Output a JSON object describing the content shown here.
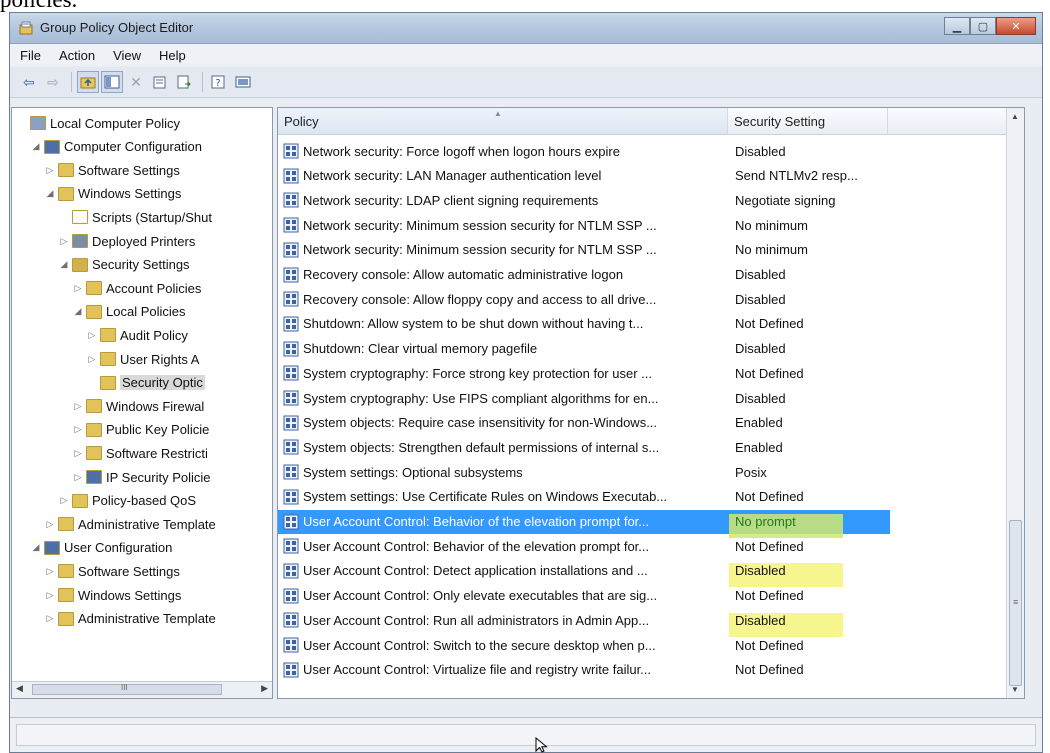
{
  "page_fragment": "policies.",
  "window": {
    "title": "Group Policy Object Editor",
    "buttons": [
      "minimize",
      "maximize",
      "close"
    ]
  },
  "menubar": [
    "File",
    "Action",
    "View",
    "Help"
  ],
  "toolbar": {
    "icons": [
      "back-icon",
      "forward-icon",
      "up-folder-icon",
      "show-hide-tree-icon",
      "delete-icon",
      "properties-icon",
      "export-list-icon",
      "help-icon",
      "console-view-icon"
    ]
  },
  "tree": {
    "nodes": [
      {
        "label": "Local Computer Policy",
        "depth": 0,
        "expander": "",
        "icon": "policy-icon"
      },
      {
        "label": "Computer Configuration",
        "depth": 1,
        "expander": "◢",
        "icon": "computer-icon"
      },
      {
        "label": "Software Settings",
        "depth": 2,
        "expander": "▷",
        "icon": "folder-icon"
      },
      {
        "label": "Windows Settings",
        "depth": 2,
        "expander": "◢",
        "icon": "folder-icon"
      },
      {
        "label": "Scripts (Startup/Shut",
        "depth": 3,
        "expander": "",
        "icon": "script-icon"
      },
      {
        "label": "Deployed Printers",
        "depth": 3,
        "expander": "▷",
        "icon": "printer-icon"
      },
      {
        "label": "Security Settings",
        "depth": 3,
        "expander": "◢",
        "icon": "security-icon"
      },
      {
        "label": "Account Policies",
        "depth": 4,
        "expander": "▷",
        "icon": "policy-folder-icon"
      },
      {
        "label": "Local Policies",
        "depth": 4,
        "expander": "◢",
        "icon": "policy-folder-icon"
      },
      {
        "label": "Audit Policy",
        "depth": 5,
        "expander": "▷",
        "icon": "policy-folder-icon"
      },
      {
        "label": "User Rights A",
        "depth": 5,
        "expander": "▷",
        "icon": "policy-folder-icon"
      },
      {
        "label": "Security Optic",
        "depth": 5,
        "expander": "",
        "icon": "policy-folder-icon",
        "selected": true
      },
      {
        "label": "Windows Firewal",
        "depth": 4,
        "expander": "▷",
        "icon": "folder-icon"
      },
      {
        "label": "Public Key Policie",
        "depth": 4,
        "expander": "▷",
        "icon": "folder-icon"
      },
      {
        "label": "Software Restricti",
        "depth": 4,
        "expander": "▷",
        "icon": "folder-icon"
      },
      {
        "label": "IP Security Policie",
        "depth": 4,
        "expander": "▷",
        "icon": "ipsec-icon"
      },
      {
        "label": "Policy-based QoS",
        "depth": 3,
        "expander": "▷",
        "icon": "qos-icon"
      },
      {
        "label": "Administrative Template",
        "depth": 2,
        "expander": "▷",
        "icon": "folder-icon"
      },
      {
        "label": "User Configuration",
        "depth": 1,
        "expander": "◢",
        "icon": "user-icon"
      },
      {
        "label": "Software Settings",
        "depth": 2,
        "expander": "▷",
        "icon": "folder-icon"
      },
      {
        "label": "Windows Settings",
        "depth": 2,
        "expander": "▷",
        "icon": "folder-icon"
      },
      {
        "label": "Administrative Template",
        "depth": 2,
        "expander": "▷",
        "icon": "folder-icon"
      }
    ],
    "scroll_glyph": "III"
  },
  "list": {
    "columns": {
      "policy": "Policy",
      "setting": "Security Setting",
      "extra": ""
    },
    "rows": [
      {
        "policy": "Network security: Force logoff when logon hours expire",
        "setting": "Disabled"
      },
      {
        "policy": "Network security: LAN Manager authentication level",
        "setting": "Send NTLMv2 resp..."
      },
      {
        "policy": "Network security: LDAP client signing requirements",
        "setting": "Negotiate signing"
      },
      {
        "policy": "Network security: Minimum session security for NTLM SSP ...",
        "setting": "No minimum"
      },
      {
        "policy": "Network security: Minimum session security for NTLM SSP ...",
        "setting": "No minimum"
      },
      {
        "policy": "Recovery console: Allow automatic administrative logon",
        "setting": "Disabled"
      },
      {
        "policy": "Recovery console: Allow floppy copy and access to all drive...",
        "setting": "Disabled"
      },
      {
        "policy": "Shutdown: Allow system to be shut down without having t...",
        "setting": "Not Defined"
      },
      {
        "policy": "Shutdown: Clear virtual memory pagefile",
        "setting": "Disabled"
      },
      {
        "policy": "System cryptography: Force strong key protection for user ...",
        "setting": "Not Defined"
      },
      {
        "policy": "System cryptography: Use FIPS compliant algorithms for en...",
        "setting": "Disabled"
      },
      {
        "policy": "System objects: Require case insensitivity for non-Windows...",
        "setting": "Enabled"
      },
      {
        "policy": "System objects: Strengthen default permissions of internal s...",
        "setting": "Enabled"
      },
      {
        "policy": "System settings: Optional subsystems",
        "setting": "Posix"
      },
      {
        "policy": "System settings: Use Certificate Rules on Windows Executab...",
        "setting": "Not Defined"
      },
      {
        "policy": "User Account Control: Behavior of the elevation prompt for...",
        "setting": "No prompt",
        "selected": true,
        "highlight": true
      },
      {
        "policy": "User Account Control: Behavior of the elevation prompt for...",
        "setting": "Not Defined"
      },
      {
        "policy": "User Account Control: Detect application installations and ...",
        "setting": "Disabled",
        "highlight": true
      },
      {
        "policy": "User Account Control: Only elevate executables that are sig...",
        "setting": "Not Defined"
      },
      {
        "policy": "User Account Control: Run all administrators in Admin App...",
        "setting": "Disabled",
        "highlight": true
      },
      {
        "policy": "User Account Control: Switch to the secure desktop when p...",
        "setting": "Not Defined"
      },
      {
        "policy": "User Account Control: Virtualize file and registry write failur...",
        "setting": "Not Defined"
      }
    ]
  },
  "colors": {
    "selection": "#3399ff",
    "highlight": "#f7f58e",
    "folder": "#e2c35a"
  }
}
